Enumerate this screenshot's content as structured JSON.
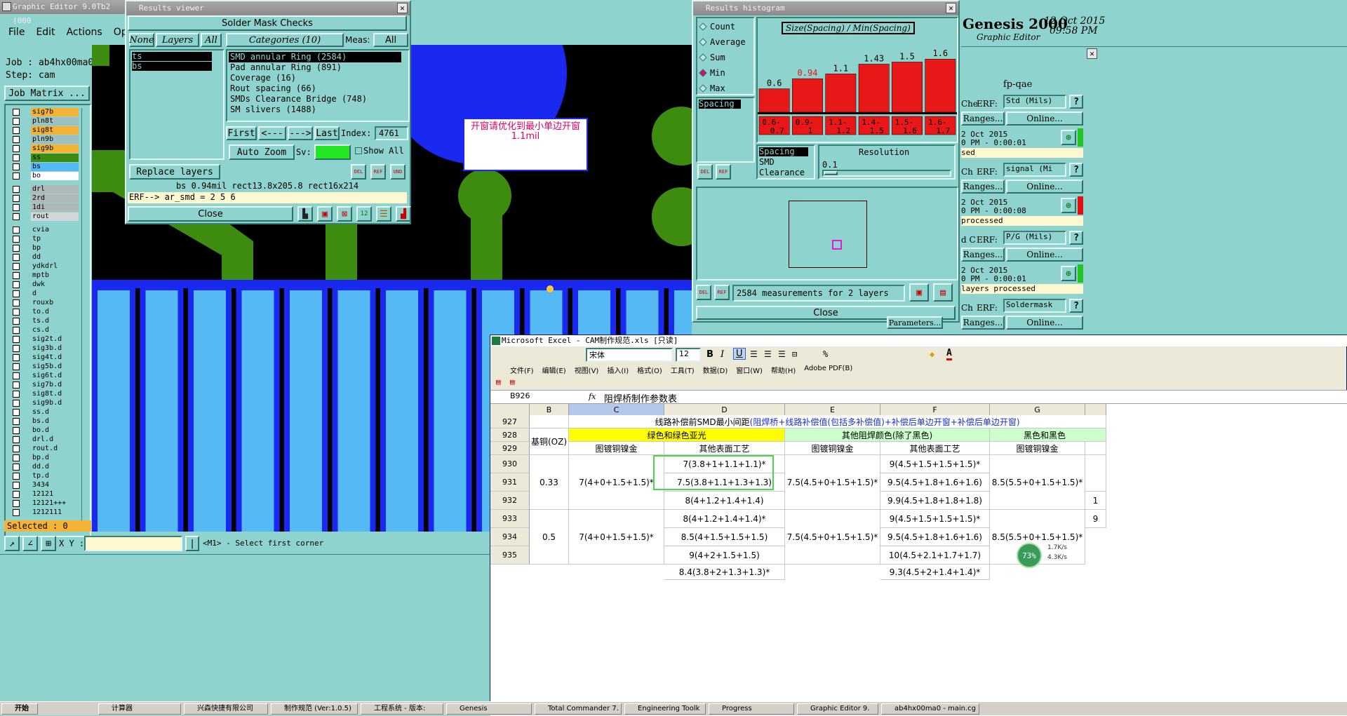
{
  "main": {
    "title": "Graphic Editor 9.0Tb2 (000",
    "menu": [
      "File",
      "Edit",
      "Actions",
      "Options"
    ],
    "job": "Job : ab4hx00ma0",
    "step": "Step: cam",
    "job_matrix": "Job Matrix ...",
    "layers": [
      "sig7b",
      "pln8t",
      "sig8t",
      "pln9b",
      "sig9b",
      "ss",
      "bs",
      "bo",
      "drl",
      "2rd",
      "1di",
      "rout",
      "cvia",
      "tp",
      "bp",
      "dd",
      "ydkdrl",
      "mptb",
      "dwk",
      "d",
      "rouxb",
      "to.d",
      "ts.d",
      "cs.d",
      "sig2t.d",
      "sig3b.d",
      "sig4t.d",
      "sig5b.d",
      "sig6t.d",
      "sig7b.d",
      "sig8t.d",
      "sig9b.d",
      "ss.d",
      "bs.d",
      "bo.d",
      "drl.d",
      "rout.d",
      "bp.d",
      "dd.d",
      "tp.d",
      "3434",
      "12121",
      "12121+++",
      "1212111"
    ],
    "selected": "Selected : 0",
    "xy_label": "X Y :",
    "xy_value": "",
    "status": "<M1> - Select first corner",
    "annotation": "开窗请优化到最小单边开窗1.1mil",
    "colors": {
      "bg": "#8fd3cf",
      "pad_blue": "#55b9f4",
      "board_green": "#3d8c10",
      "blue": "#1a28f0"
    }
  },
  "results_viewer": {
    "title": "Results viewer",
    "header": "Solder Mask Checks",
    "btn_none": "None",
    "btn_layers": "Layers",
    "btn_all": "All",
    "categories_label": "Categories (10)",
    "meas_label": "Meas:",
    "meas_value": "All",
    "layers": [
      "ts",
      "bs"
    ],
    "categories": [
      "SMD annular Ring (2584)",
      "Pad annular Ring (891)",
      "Coverage (16)",
      "Rout spacing (66)",
      "SMDs Clearance Bridge (748)",
      "SM slivers (1488)"
    ],
    "btn_first": "First",
    "btn_prev": "<---",
    "btn_next": "--->",
    "btn_last": "Last",
    "index_label": "Index:",
    "index_value": "4761",
    "auto_zoom": "Auto Zoom",
    "sv_label": "Sv:",
    "show_all": "Show All",
    "replace_layers": "Replace layers",
    "icon_del": "DEL",
    "icon_ref": "REF",
    "icon_und": "UND",
    "info": "bs 0.94mil  rect13.8x205.8  rect16x214",
    "erf": "ERF--> ar_smd = 2 5 6",
    "close": "Close"
  },
  "histogram": {
    "title": "Results histogram",
    "radios": [
      "Count",
      "Average",
      "Sum",
      "Min",
      "Max"
    ],
    "selected_radio": "Min",
    "chart_title": "Size(Spacing) / Min(Spacing)",
    "list1": [
      "Spacing"
    ],
    "list2": [
      "Spacing",
      "SMD",
      "Clearance"
    ],
    "resolution_label": "Resolution",
    "resolution_value": "0.1",
    "summary": "2584 measurements for 2 layers",
    "close": "Close",
    "icon_del": "DEL",
    "icon_ref": "REF"
  },
  "chart_data": {
    "type": "bar",
    "title": "Size(Spacing) / Min(Spacing)",
    "categories": [
      "0.6-0.7",
      "0.9-1",
      "1.1-1.2",
      "1.4-1.5",
      "1.5-1.6",
      "1.6-1.7"
    ],
    "values": [
      0.6,
      0.94,
      1.1,
      1.43,
      1.5,
      1.6
    ],
    "value_labels": [
      "0.6",
      "0.94",
      "1.1",
      "1.43",
      "1.5",
      "1.6"
    ],
    "highlight_index": 1,
    "bar_color": "#e81818",
    "ylim": [
      0,
      1.7
    ]
  },
  "genesis": {
    "title": "Genesis 2000",
    "subtitle": "Graphic Editor",
    "date": "12 Oct 2015",
    "time": "09:58 PM",
    "panel_title": "fp-qae",
    "blocks": [
      {
        "label": "Che",
        "erf": "ERF:",
        "erf_value": "Std (Mils)",
        "ranges": "Ranges...",
        "online": "Online...",
        "date": "2 Oct 2015",
        "time": "0 PM - 0:00:01",
        "status": "sed"
      },
      {
        "label": "Ch",
        "erf": "ERF:",
        "erf_value": "signal (Mi",
        "ranges": "Ranges...",
        "online": "Online...",
        "date": "2 Oct 2015",
        "time": "0 PM - 0:00:08",
        "status": "processed"
      },
      {
        "label": "d C",
        "erf": "ERF:",
        "erf_value": "P/G (Mils)",
        "ranges": "Ranges...",
        "online": "Online...",
        "date": "2 Oct 2015",
        "time": "0 PM - 0:00:01",
        "status": "layers processed"
      },
      {
        "label": "Ch",
        "erf": "ERF:",
        "erf_value": "Soldermask",
        "ranges": "Ranges...",
        "online": "Online...",
        "date": "",
        "time": "",
        "status": ""
      }
    ],
    "parameters": "Parameters..."
  },
  "excel": {
    "title": "Microsoft Excel - CAM制作规范.xls  [只读]",
    "font": "宋体",
    "font_size": "12",
    "menus": [
      "文件(F)",
      "编辑(E)",
      "视图(V)",
      "插入(I)",
      "格式(O)",
      "工具(T)",
      "数据(D)",
      "窗口(W)",
      "帮助(H)",
      "Adobe PDF(B)"
    ],
    "name_box": "B926",
    "fx": "fx",
    "formula": "阻焊桥制作参数表",
    "cols": [
      "B",
      "C",
      "D",
      "E",
      "F",
      "G"
    ],
    "rows": [
      "927",
      "928",
      "929",
      "930",
      "931",
      "932",
      "933",
      "934",
      "935"
    ],
    "r927_black": "线路补偿前SMD最小间距",
    "r927_blue": "(阻焊桥+线路补偿值(包括多补偿值)+补偿后单边开窗+补偿后单边开窗)",
    "base_copper": "基铜(OZ)",
    "green_header": "绿色和绿色亚光",
    "other_header": "其他阻焊颜色(除了黑色)",
    "black_header": "黑色和黑色",
    "sub_gold": "图镀铜镍金",
    "sub_other": "其他表面工艺",
    "b_033": "0.33",
    "b_05": "0.5",
    "c_033": "7(4+0+1.5+1.5)*",
    "d930": "7(3.8+1+1.1+1.1)*",
    "d931": "7.5(3.8+1.1+1.3+1.3)",
    "d932": "8(4+1.2+1.4+1.4)",
    "e_033": "7.5(4.5+0+1.5+1.5)*",
    "f930": "9(4.5+1.5+1.5+1.5)*",
    "f931": "9.5(4.5+1.8+1.6+1.6)",
    "f932": "9.9(4.5+1.8+1.8+1.8)",
    "g_033": "8.5(5.5+0+1.5+1.5)*",
    "c_05": "7(4+0+1.5+1.5)*",
    "d933": "8(4+1.2+1.4+1.4)*",
    "d934": "8.5(4+1.5+1.5+1.5)",
    "d935": "9(4+2+1.5+1.5)",
    "d936": "8.4(3.8+2+1.3+1.3)*",
    "e_05": "7.5(4.5+0+1.5+1.5)*",
    "f933": "9(4.5+1.5+1.5+1.5)*",
    "f934": "9.5(4.5+1.8+1.6+1.6)",
    "f935": "10(4.5+2.1+1.7+1.7)",
    "f936": "9.3(4.5+2+1.4+1.4)*",
    "g_05": "8.5(5.5+0+1.5+1.5)*",
    "h932": "1",
    "h933": "9"
  },
  "net": {
    "percent": "73%",
    "up": "1.7K/s",
    "down": "4.3K/s"
  },
  "taskbar": {
    "start": "开始",
    "items": [
      "计算器",
      "兴森快捷有限公司",
      "制作规范 (Ver:1.0.5)",
      "工程系统 - 版本:",
      "Genesis",
      "Total Commander 7.",
      "Engineering Toolk",
      "Progress",
      "Graphic Editor 9.",
      "ab4hx00ma0 - main.cg"
    ]
  }
}
